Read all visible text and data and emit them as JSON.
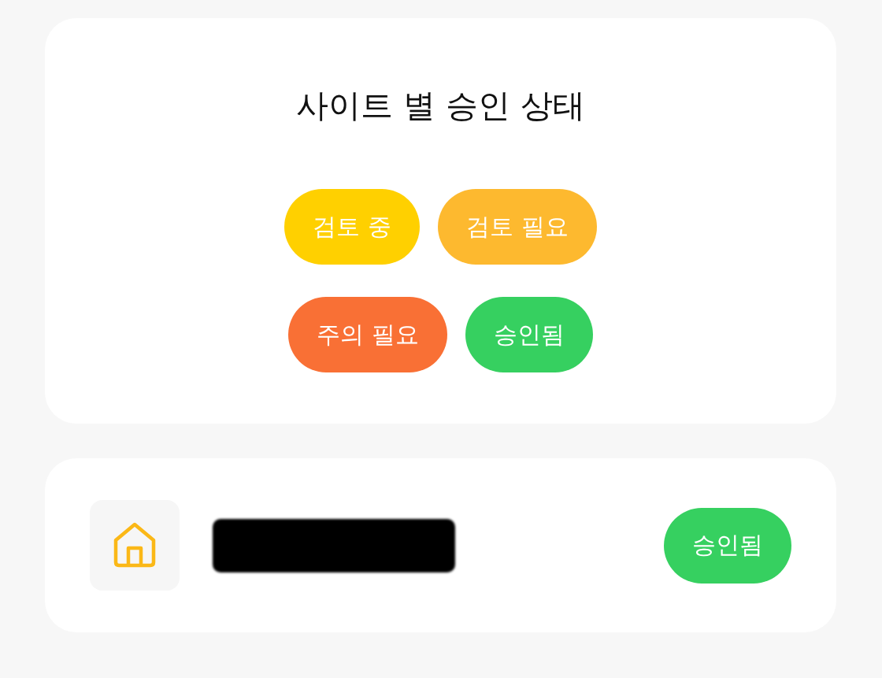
{
  "status_card": {
    "title": "사이트 별 승인 상태",
    "legend_rows": [
      [
        {
          "label": "검토 중",
          "color": "#ffd000"
        },
        {
          "label": "검토 필요",
          "color": "#fdb92f"
        }
      ],
      [
        {
          "label": "주의 필요",
          "color": "#f97035"
        },
        {
          "label": "승인됨",
          "color": "#36d060"
        }
      ]
    ]
  },
  "sites": [
    {
      "name_redacted": true,
      "status": {
        "label": "승인됨",
        "color": "#36d060"
      }
    }
  ]
}
